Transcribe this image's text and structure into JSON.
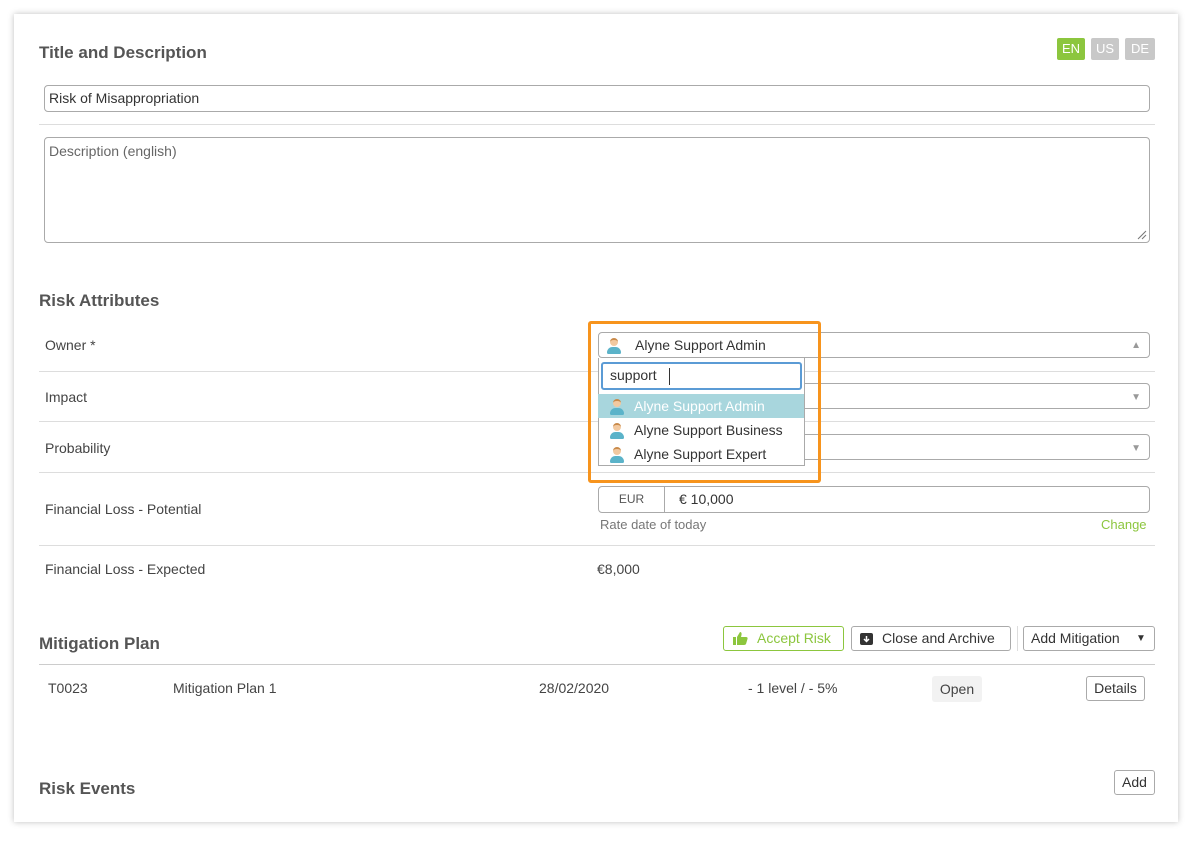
{
  "title_section": {
    "heading": "Title and Description",
    "languages": [
      {
        "code": "EN",
        "color": "#8cc63e"
      },
      {
        "code": "US",
        "color": "#c8c8c8"
      },
      {
        "code": "DE",
        "color": "#c8c8c8"
      }
    ],
    "title_value": "Risk of Misappropriation",
    "description_placeholder": "Description (english)"
  },
  "risk_attributes": {
    "heading": "Risk Attributes",
    "owner_label": "Owner *",
    "owner_value": "Alyne Support Admin",
    "impact_label": "Impact",
    "probability_label": "Probability",
    "fin_potential_label": "Financial Loss - Potential",
    "currency": "EUR",
    "fin_potential_value": "€ 10,000",
    "rate_note": "Rate date of today",
    "change_link": "Change",
    "fin_expected_label": "Financial Loss - Expected",
    "fin_expected_value": "€8,000"
  },
  "owner_dropdown": {
    "search_value": "support",
    "options": [
      {
        "label": "Alyne Support Admin",
        "selected": true
      },
      {
        "label": "Alyne Support Business",
        "selected": false
      },
      {
        "label": "Alyne Support Expert",
        "selected": false
      }
    ],
    "highlight_color": "#f7941d"
  },
  "mitigation_plan": {
    "heading": "Mitigation Plan",
    "accept_risk_label": "Accept Risk",
    "close_archive_label": "Close and Archive",
    "add_mitigation_label": "Add Mitigation",
    "rows": [
      {
        "id": "T0023",
        "name": "Mitigation Plan 1",
        "date": "28/02/2020",
        "reduction": "- 1 level / - 5%",
        "status": "Open",
        "action": "Details"
      }
    ]
  },
  "risk_events": {
    "heading": "Risk Events",
    "add_label": "Add"
  },
  "colors": {
    "accent_green": "#8cc63e",
    "selection_blue": "#a8d6dd",
    "focus_blue": "#5b9bd5"
  }
}
